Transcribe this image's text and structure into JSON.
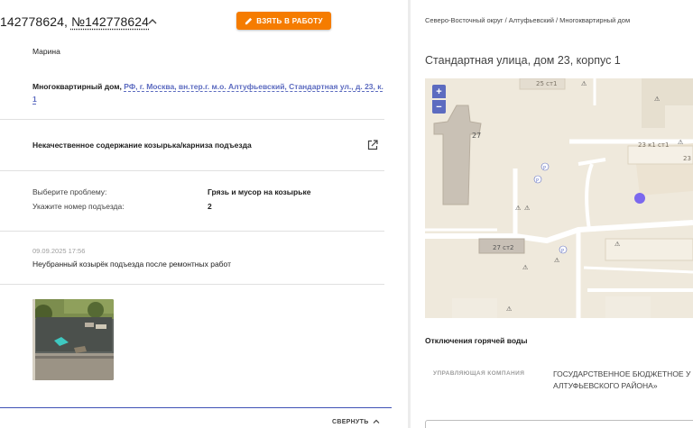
{
  "request": {
    "title_prefix": "142778624, ",
    "title_number": "№142778624",
    "take_button": "ВЗЯТЬ В РАБОТУ",
    "author": "Марина",
    "address_type": "Многоквартирный дом",
    "address_sep": ", ",
    "address_link": "РФ, г. Москва, вн.тер.г. м.о. Алтуфьевский, Стандартная ул., д. 23, к. 1",
    "category": "Некачественное содержание козырька/карниза подъезда",
    "details": [
      {
        "label": "Выберите проблему:",
        "value": "Грязь и мусор на козырьке"
      },
      {
        "label": "Укажите номер подъезда:",
        "value": "2"
      }
    ],
    "comment_date": "09.09.2025 17:56",
    "comment_text": "Неубранный козырёк подъезда после ремонтных работ",
    "collapse_label": "СВЕРНУТЬ"
  },
  "object": {
    "breadcrumb": "Северо-Восточный округ / Алтуфьевский / Многоквартирный дом",
    "title": "Стандартная улица, дом 23, корпус 1",
    "map": {
      "zoom_in": "+",
      "zoom_out": "−",
      "labels": [
        "25 ст1",
        "27",
        "23 к1 ст1",
        "23",
        "27 ст2",
        "P"
      ]
    },
    "outage": "Отключения горячей воды",
    "management_label": "УПРАВЛЯЮЩАЯ КОМПАНИЯ",
    "management_value": "ГОСУДАРСТВЕННОЕ БЮДЖЕТНОЕ У АЛТУФЬЕВСКОГО РАЙОНА»"
  },
  "colors": {
    "accent": "#f57c00",
    "link": "#5c6bc0",
    "map_marker": "#7b68ee",
    "map_bg": "#efe9dc"
  }
}
